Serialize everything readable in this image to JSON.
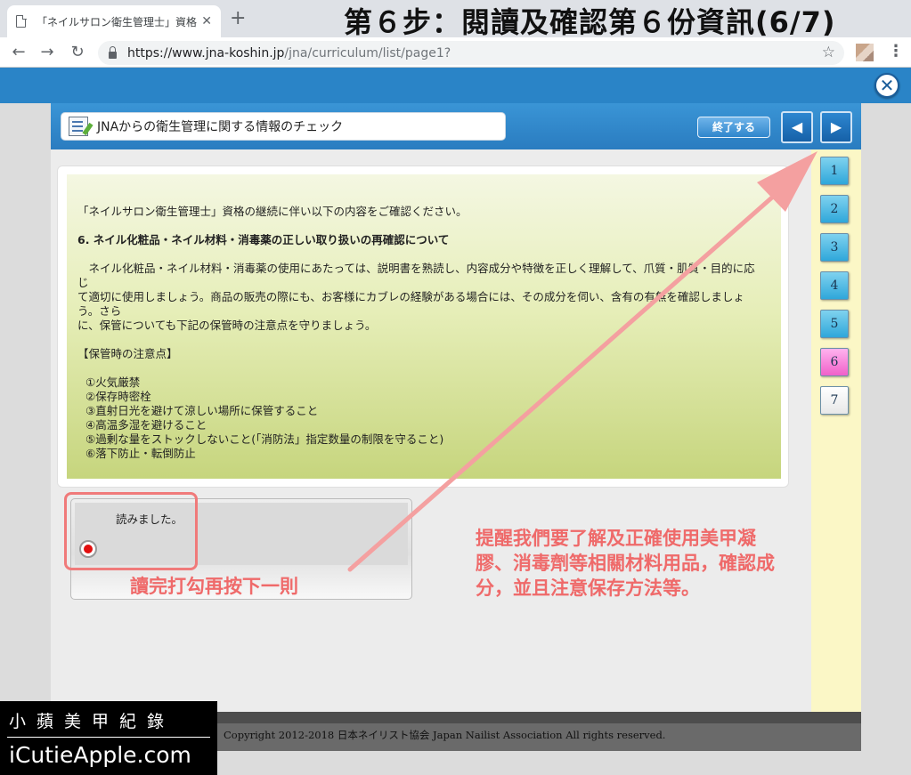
{
  "browser": {
    "tab_title": "「ネイルサロン衛生管理士」資格",
    "tab_close": "✕",
    "new_tab": "+",
    "back": "←",
    "forward": "→",
    "reload": "↻",
    "url_host": "https://www.jna-koshin.jp",
    "url_path": "/jna/curriculum/list/page1?",
    "star": "☆",
    "menu": "⋮"
  },
  "overlay_title": "第６步：閱讀及確認第６份資訊(6/7)",
  "app": {
    "close": "✕",
    "title": "JNAからの衛生管理に関する情報のチェック",
    "end_button": "終了する",
    "prev": "◀",
    "next": "▶"
  },
  "content": {
    "intro": "「ネイルサロン衛生管理士」資格の継続に伴い以下の内容をご確認ください。",
    "heading": "6. ネイル化粧品・ネイル材料・消毒薬の正しい取り扱いの再確認について",
    "para_line1": "　ネイル化粧品・ネイル材料・消毒薬の使用にあたっては、説明書を熟読し、内容成分や特徴を正しく理解して、爪質・肌質・目的に応じ",
    "para_line2": "て適切に使用しましょう。商品の販売の際にも、お客様にカブレの経験がある場合には、その成分を伺い、含有の有無を確認しましょう。さら",
    "para_line3": "に、保管についても下記の保管時の注意点を守りましょう。",
    "storage_heading": "【保管時の注意点】",
    "items": [
      "①火気厳禁",
      "②保存時密栓",
      "③直射日光を避けて涼しい場所に保管すること",
      "④高温多湿を避けること",
      "⑤過剰な量をストックしないこと(「消防法」指定数量の制限を守ること)",
      "⑥落下防止・転倒防止"
    ]
  },
  "confirm": {
    "label": "読みました。",
    "checked": true
  },
  "pages": [
    {
      "label": "1",
      "state": "done"
    },
    {
      "label": "2",
      "state": "done"
    },
    {
      "label": "3",
      "state": "done"
    },
    {
      "label": "4",
      "state": "done"
    },
    {
      "label": "5",
      "state": "done"
    },
    {
      "label": "6",
      "state": "current"
    },
    {
      "label": "7",
      "state": "inactive"
    }
  ],
  "footer": {
    "copyright": "Copyright 2012-2018 日本ネイリスト協会 Japan Nailist Association All rights reserved."
  },
  "annotations": {
    "note": "讀完打勾再按下一則",
    "caption": "提醒我們要了解及正確使用美甲凝膠、消毒劑等相關材料用品，確認成分，並且注意保存方法等。",
    "color": "#ef6a6a"
  },
  "watermark": {
    "cn": "小蘋美甲紀錄",
    "en": "iCutieApple.com"
  },
  "colors": {
    "app_blue": "#2a84c7",
    "page_done": "#2fa7da",
    "page_current": "#f060c9",
    "radio_fill": "#e20f0f"
  }
}
